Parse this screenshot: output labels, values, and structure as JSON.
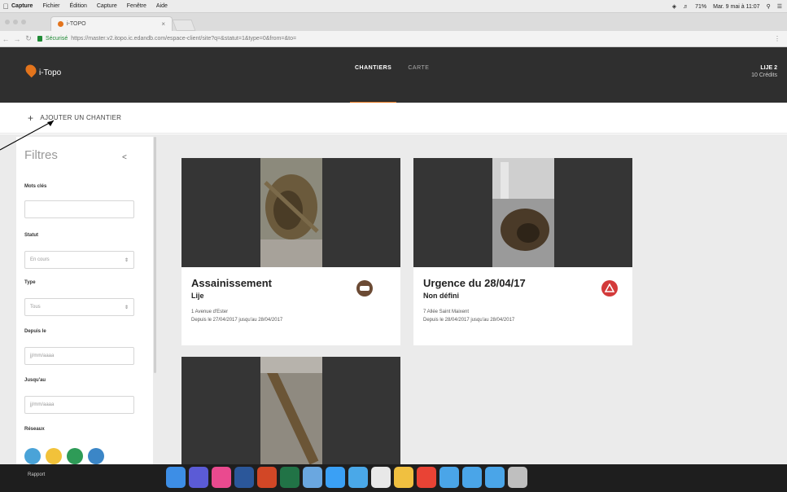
{
  "menubar": {
    "app": "Capture",
    "items": [
      "Fichier",
      "Édition",
      "Capture",
      "Fenêtre",
      "Aide"
    ],
    "battery": "71%",
    "datetime": "Mar. 9 mai à 11:07"
  },
  "browser": {
    "tab_title": "i-TOPO",
    "secure_label": "Sécurisé",
    "url": "https://master.v2.itopo.ic.edandb.com/espace-client/site?q=&statut=1&type=0&from=&to="
  },
  "header": {
    "logo_text": "i-Topo",
    "nav": [
      "CHANTIERS",
      "CARTE"
    ],
    "user_name": "LIJE 2",
    "user_credits": "10 Crédits"
  },
  "addbar": {
    "label": "AJOUTER UN CHANTIER"
  },
  "filters": {
    "title": "Filtres",
    "collapse": "<",
    "keywords_label": "Mots clés",
    "status_label": "Statut",
    "status_value": "En cours",
    "type_label": "Type",
    "type_value": "Tous",
    "from_label": "Depuis le",
    "from_placeholder": "jj/mm/aaaa",
    "to_label": "Jusqu'au",
    "to_placeholder": "jj/mm/aaaa",
    "networks_label": "Réseaux",
    "network_colors": [
      "#4aa3d8",
      "#f2c23a",
      "#2e9b57",
      "#3b86c7"
    ]
  },
  "cards": [
    {
      "title": "Assainissement",
      "subtitle": "Lije",
      "address": "1 Avenue d'Ester",
      "dates": "Depuis le 27/04/2017 jusqu'au 28/04/2017",
      "badge_color": "#6b4a34"
    },
    {
      "title": "Urgence du 28/04/17",
      "subtitle": "Non défini",
      "address": "7 Allée Saint Maixent",
      "dates": "Depuis le 28/04/2017 jusqu'au 28/04/2017",
      "badge_color": "#d33a3a"
    },
    {
      "title": "",
      "subtitle": "",
      "address": "",
      "dates": ""
    }
  ],
  "dock": {
    "label": "Rapport"
  },
  "colors": {
    "accent": "#e3741c",
    "header_bg": "#2f2f2f",
    "content_bg": "#ebebeb"
  }
}
